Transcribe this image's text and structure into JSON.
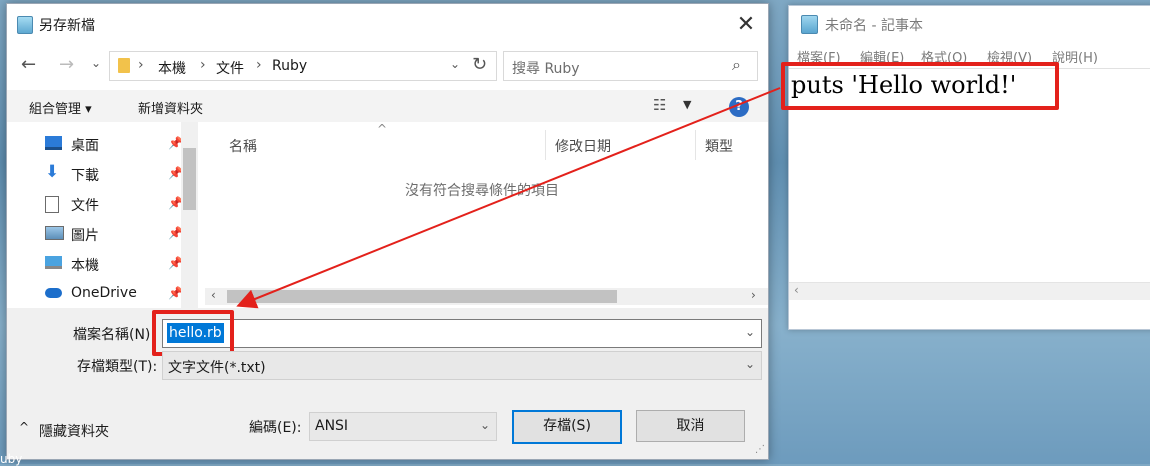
{
  "notepad": {
    "title": "未命名 - 記事本",
    "menus": [
      "檔案(F)",
      "編輯(E)",
      "格式(O)",
      "檢視(V)",
      "說明(H)"
    ],
    "content": "puts 'Hello world!'"
  },
  "dialog": {
    "title": "另存新檔",
    "close_glyph": "✕",
    "breadcrumbs": [
      "本機",
      "文件",
      "Ruby"
    ],
    "search_placeholder": "搜尋 Ruby",
    "toolbar": {
      "organize": "組合管理 ▾",
      "new_folder": "新增資料夾",
      "help": "?"
    },
    "nav_items": [
      {
        "label": "桌面",
        "icon": "desktop-icon"
      },
      {
        "label": "下載",
        "icon": "download-icon"
      },
      {
        "label": "文件",
        "icon": "document-icon"
      },
      {
        "label": "圖片",
        "icon": "picture-icon"
      },
      {
        "label": "本機",
        "icon": "computer-icon"
      },
      {
        "label": "OneDrive",
        "icon": "cloud-icon"
      }
    ],
    "columns": [
      "名稱",
      "修改日期",
      "類型"
    ],
    "empty_message": "沒有符合搜尋條件的項目",
    "filename_label": "檔案名稱(N):",
    "filename_value": "hello.rb",
    "filetype_label": "存檔類型(T):",
    "filetype_value": "文字文件(*.txt)",
    "hide_folders": "隱藏資料夾",
    "encoding_label": "編碼(E):",
    "encoding_value": "ANSI",
    "save_button": "存檔(S)",
    "cancel_button": "取消"
  },
  "desktop_fragment": "uby"
}
